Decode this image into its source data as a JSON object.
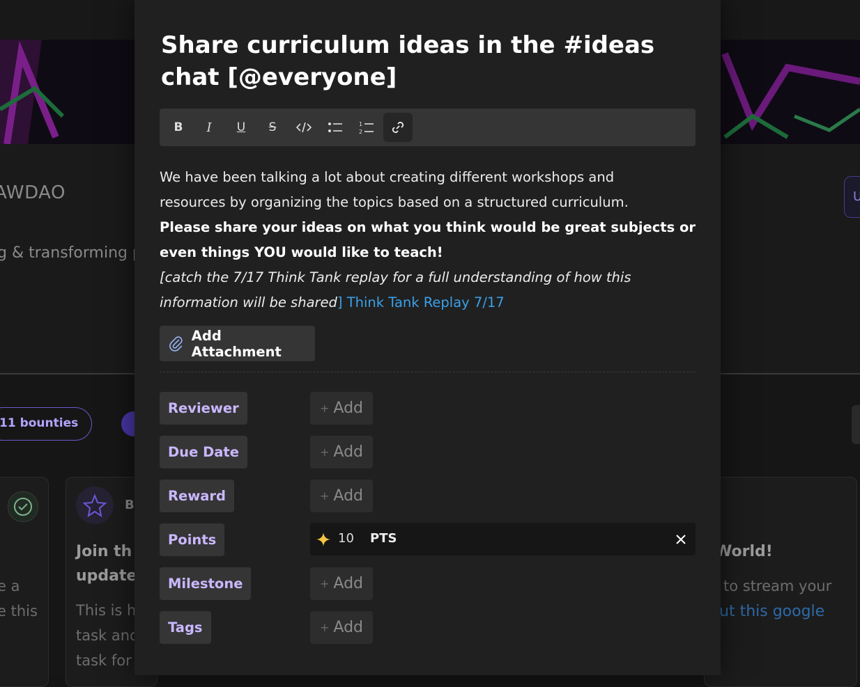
{
  "background": {
    "org_name": "AWDAO",
    "org_description": "g & transforming p",
    "right_chip": "U",
    "bounties": "11 bounties",
    "card_mid": {
      "badge": "B",
      "title_line1": "Join th",
      "title_line2": "update",
      "body_line1": "This is h",
      "body_line2": "task and",
      "body_line3": "task for"
    },
    "card_left": {
      "body_line1": "e a",
      "body_line2": "e this"
    },
    "card_right": {
      "title": "World!",
      "body_line1": "to stream your",
      "link": "ut this google"
    }
  },
  "modal": {
    "title": "Share curriculum ideas in the #ideas chat [@everyone]",
    "toolbar": [
      "bold",
      "italic",
      "underline",
      "strikethrough",
      "code",
      "bulleted-list",
      "numbered-list",
      "link"
    ],
    "description": {
      "para1": "We have been talking a lot about creating different workshops and resources by organizing the topics based on a structured curriculum.",
      "para2": "Please share your ideas on what you think would be great subjects or even things YOU would like to teach!",
      "para3_italic": "[catch the 7/17 Think Tank replay for a full understanding of how this information will be shared",
      "para3_bracket": "]",
      "para3_link": "Think Tank Replay 7/17"
    },
    "attachment_label": "Add Attachment",
    "properties": {
      "reviewer": {
        "label": "Reviewer",
        "action": "Add"
      },
      "due_date": {
        "label": "Due Date",
        "action": "Add"
      },
      "reward": {
        "label": "Reward",
        "action": "Add"
      },
      "points": {
        "label": "Points",
        "value": "10",
        "unit": "PTS"
      },
      "milestone": {
        "label": "Milestone",
        "action": "Add"
      },
      "tags": {
        "label": "Tags",
        "action": "Add"
      }
    },
    "colors": {
      "accent_label": "#c9b8ff",
      "link": "#3aa0e8",
      "star": "#f5c542"
    }
  }
}
